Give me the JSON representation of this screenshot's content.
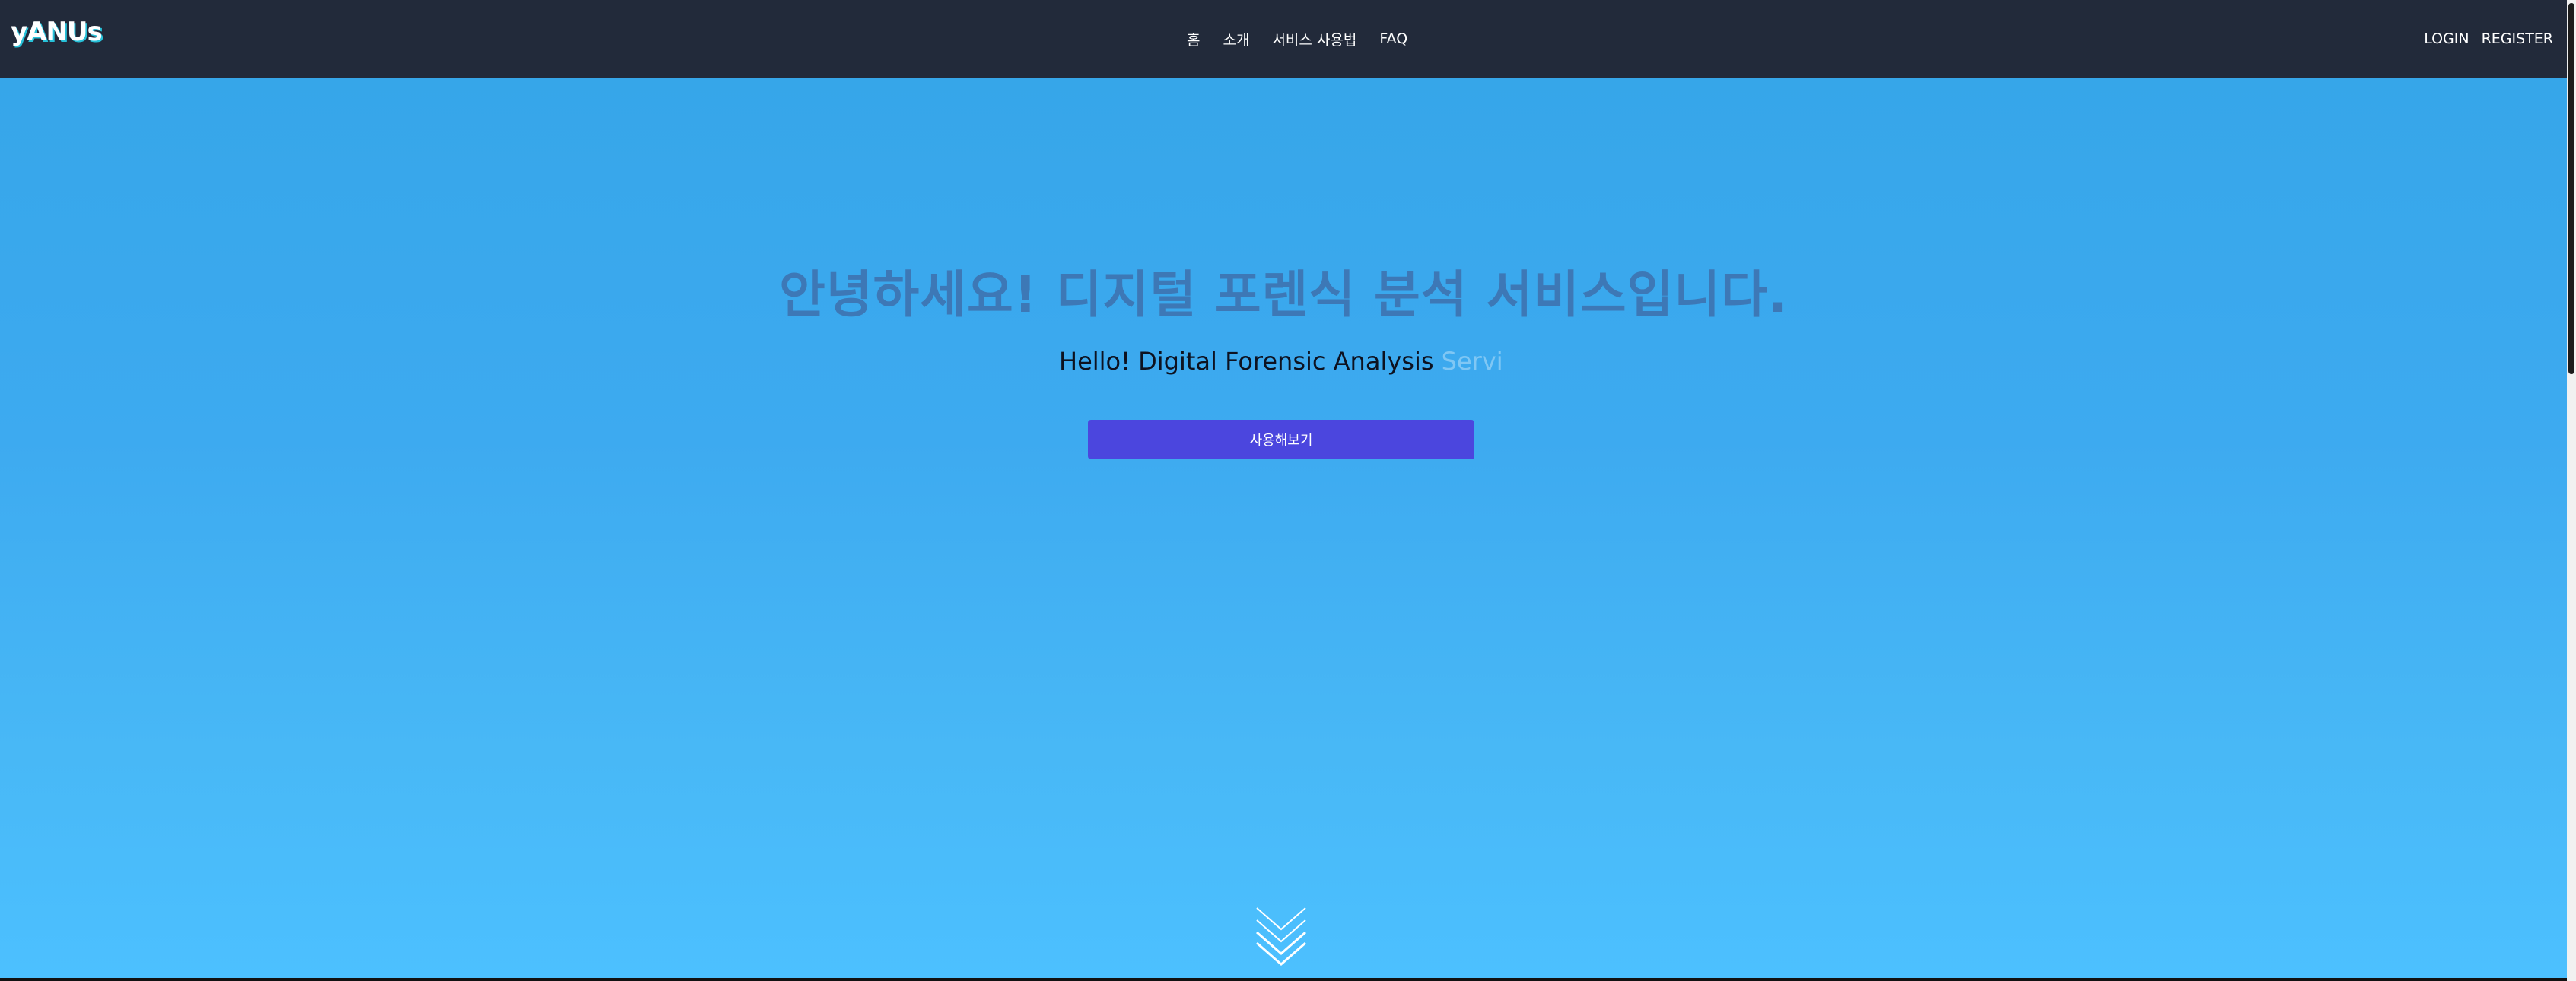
{
  "header": {
    "logo": "yANUs",
    "nav": [
      {
        "label": "홈"
      },
      {
        "label": "소개"
      },
      {
        "label": "서비스 사용법"
      },
      {
        "label": "FAQ"
      }
    ],
    "auth": {
      "login": "LOGIN",
      "register": "REGISTER"
    }
  },
  "hero": {
    "title": "안녕하세요! 디지털 포렌식 분석 서비스입니다.",
    "subtitle_visible": "Hello! Digital Forensic Analysis",
    "subtitle_faded": "Servi",
    "cta_label": "사용해보기",
    "scroll_icon": "chevron-double-down-icon"
  },
  "colors": {
    "navbar": "#222a3a",
    "hero_top": "#36a6e9",
    "hero_bottom": "#4cc0ff",
    "title": "#3d78b6",
    "cta": "#4b46de"
  }
}
